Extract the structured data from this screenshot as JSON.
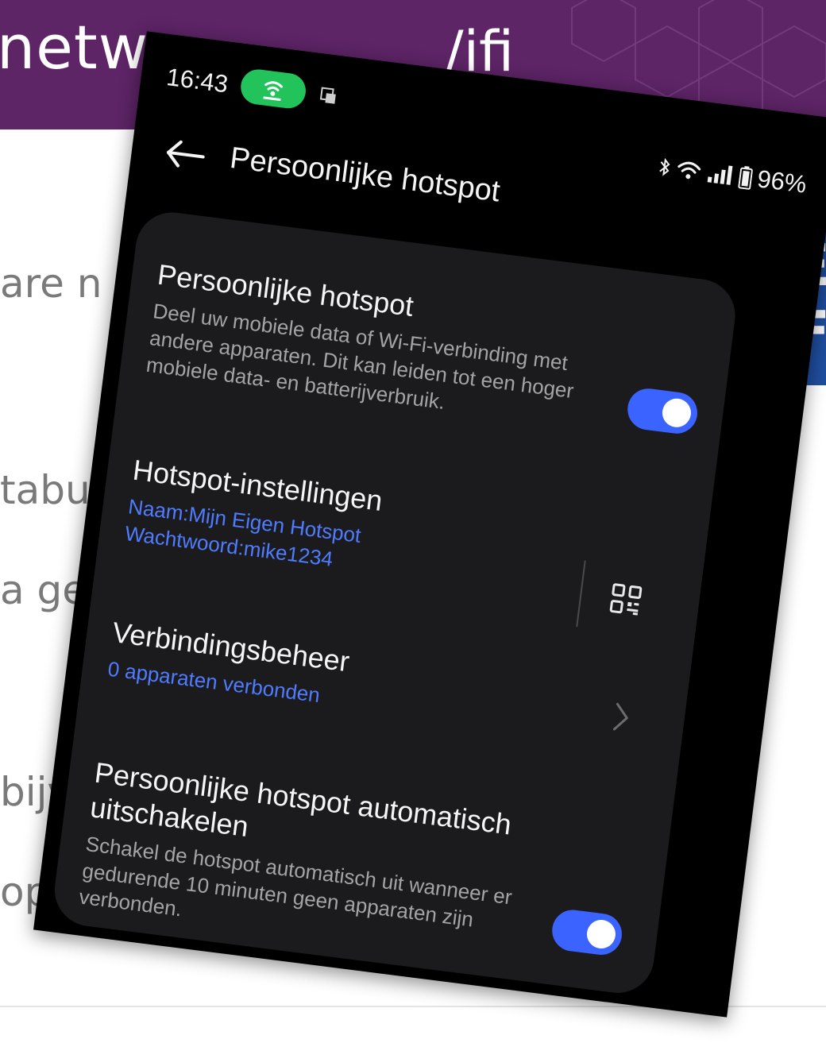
{
  "background_slide": {
    "title_fragment": "netwe",
    "title_tail_fragment": "/ifi",
    "bullets": [
      "are n",
      "tabu",
      "a ge",
      "bijv",
      "op"
    ],
    "logo_fragments": [
      "E",
      "F"
    ],
    "header_color": "#5d2466"
  },
  "status_bar": {
    "time": "16:43",
    "battery": "96%",
    "icons": [
      "hotspot-icon",
      "notification-icon",
      "bluetooth-icon",
      "wifi-icon",
      "signal-icon",
      "battery-icon"
    ]
  },
  "screen": {
    "title": "Persoonlijke hotspot"
  },
  "settings": {
    "hotspot": {
      "title": "Persoonlijke hotspot",
      "description": "Deel uw mobiele data of Wi-Fi-verbinding met andere apparaten. Dit kan leiden tot een hoger mobiele data- en batterijverbruik.",
      "enabled": true
    },
    "hotspot_settings": {
      "title": "Hotspot-instellingen",
      "name_line": "Naam:Mijn Eigen Hotspot",
      "password_line": "Wachtwoord:mike1234"
    },
    "connection_management": {
      "title": "Verbindingsbeheer",
      "subtitle": "0 apparaten verbonden"
    },
    "auto_off": {
      "title": "Persoonlijke hotspot automatisch uitschakelen",
      "description": "Schakel de hotspot automatisch uit wanneer er gedurende 10 minuten geen apparaten zijn verbonden.",
      "enabled": true
    }
  },
  "colors": {
    "accent": "#3a63ff",
    "link": "#4f7cff",
    "hotspot_pill": "#22c35a",
    "card": "#1b1b1d"
  }
}
